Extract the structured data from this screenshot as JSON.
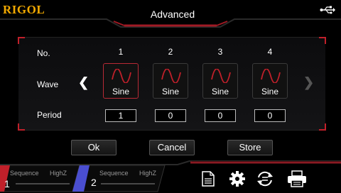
{
  "header": {
    "brand": "RIGOL",
    "title": "Advanced",
    "usb_icon": "usb-icon"
  },
  "table": {
    "row_labels": {
      "number": "No.",
      "wave": "Wave",
      "period": "Period"
    },
    "columns": [
      {
        "number": "1",
        "wave": "Sine",
        "period": "1",
        "selected": true
      },
      {
        "number": "2",
        "wave": "Sine",
        "period": "0",
        "selected": false
      },
      {
        "number": "3",
        "wave": "Sine",
        "period": "0",
        "selected": false
      },
      {
        "number": "4",
        "wave": "Sine",
        "period": "0",
        "selected": false
      }
    ],
    "prev_arrow": "chevron-left-icon",
    "next_arrow": "chevron-right-icon"
  },
  "buttons": {
    "ok": "Ok",
    "cancel": "Cancel",
    "store": "Store"
  },
  "channels": [
    {
      "number": "1",
      "mode": "Sequence",
      "impedance": "HighZ",
      "accent": "#c0202a"
    },
    {
      "number": "2",
      "mode": "Sequence",
      "impedance": "HighZ",
      "accent": "#4a4ed0"
    }
  ],
  "toolbar": {
    "icons": [
      "document-icon",
      "gear-icon",
      "sync-icon",
      "printer-icon"
    ]
  },
  "colors": {
    "brand": "#f2a900",
    "accent_red": "#c0202a",
    "ch2_blue": "#4a4ed0"
  }
}
